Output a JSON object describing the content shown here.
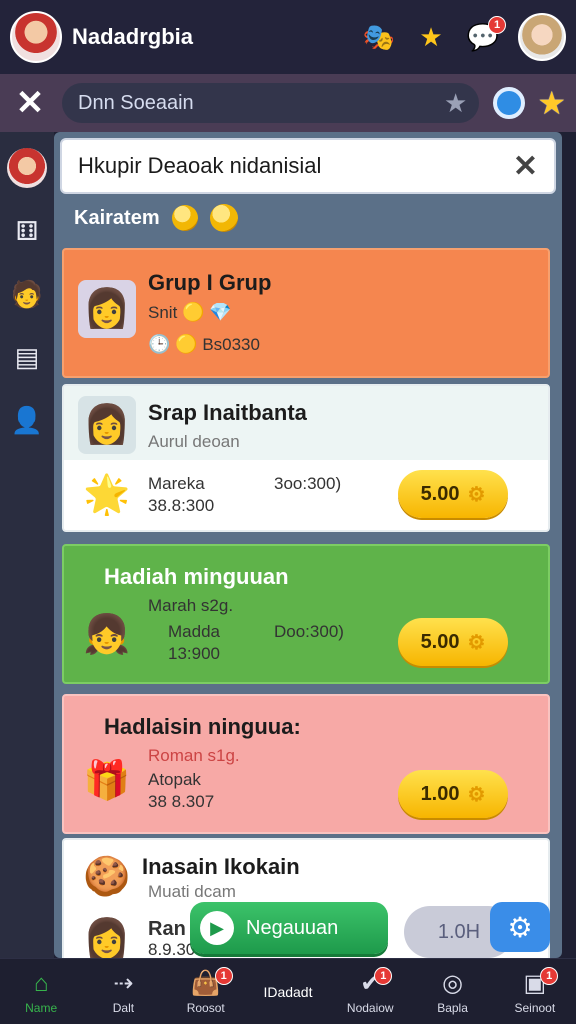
{
  "header": {
    "app_title": "Nadadrgbia",
    "icons": [
      "mask-icon",
      "star-icon",
      "chat-icon"
    ],
    "chat_badge": "1"
  },
  "search": {
    "placeholder": "Dnn Soeaain"
  },
  "rail": {
    "items": [
      "avatar",
      "dice-icon",
      "profile-icon",
      "list-icon",
      "user-icon"
    ]
  },
  "rule_box": {
    "text": "Hkupir Deaoak nidanisial"
  },
  "section": {
    "label": "Kairatem"
  },
  "cards": [
    {
      "title": "Grup I Grup",
      "line1": "Snit",
      "line2": "Bs0330",
      "color": "#f5864f"
    },
    {
      "title": "Srap Inaitbanta",
      "subtitle": "Aurul deoan",
      "item_name": "Mareka",
      "item_value": "38.8:300",
      "extra": "3oo:300)",
      "price": "5.00",
      "color": "#ffffff"
    },
    {
      "title": "Hadiah minguuan",
      "subtitle": "Marah s2g.",
      "item_name": "Madda",
      "item_value": "13:900",
      "extra": "Doo:300)",
      "price": "5.00",
      "color": "#5fb34a"
    },
    {
      "title": "Hadlaisin ninguua:",
      "subtitle": "Roman s1g.",
      "item_name": "Atopak",
      "item_value": "38 8.307",
      "price": "1.00",
      "color": "#f7a9a6"
    },
    {
      "title": "Inasain Ikokain",
      "subtitle": "Muati dcam",
      "item_name": "Ran",
      "item_value": "8.9.309",
      "color": "#ffffff"
    }
  ],
  "actions": {
    "confirm_label": "Negauuan",
    "grey_label": "1.0H"
  },
  "bottom_nav": [
    {
      "label": "Name",
      "icon": "home-icon",
      "active": true
    },
    {
      "label": "Dalt",
      "icon": "arrow-icon"
    },
    {
      "label": "Roosot",
      "icon": "bag-icon",
      "badge": "1"
    },
    {
      "label": "IDadadt",
      "icon": ""
    },
    {
      "label": "Nodaiow",
      "icon": "check-icon",
      "badge": "1"
    },
    {
      "label": "Bapla",
      "icon": "compass-icon"
    },
    {
      "label": "Seinoot",
      "icon": "box-icon",
      "badge": "1"
    }
  ]
}
